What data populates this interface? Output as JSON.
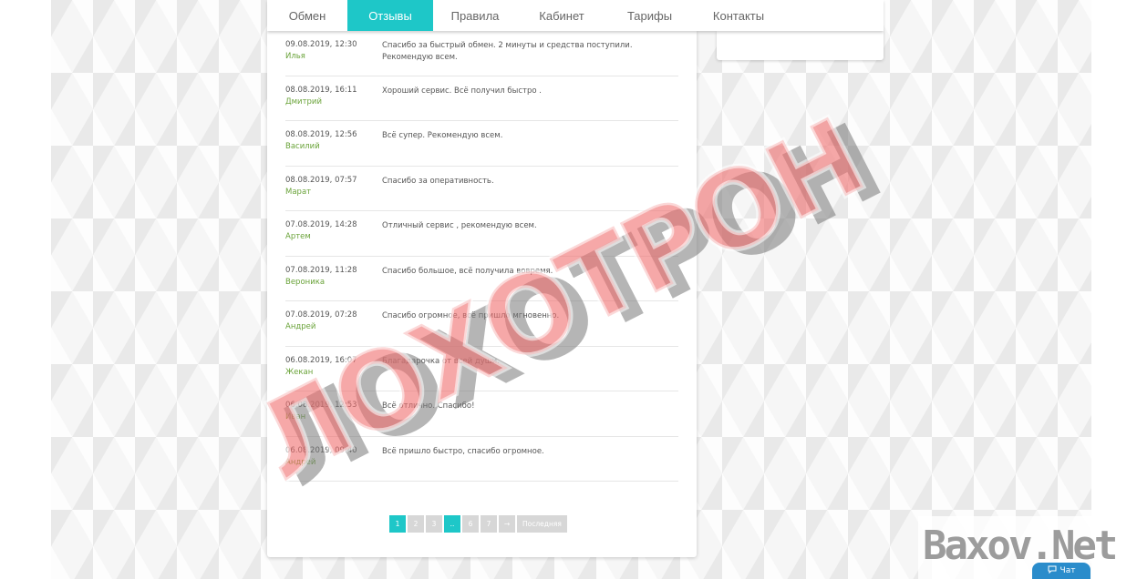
{
  "nav": {
    "tabs": [
      {
        "label": "Обмен"
      },
      {
        "label": "Отзывы"
      },
      {
        "label": "Правила"
      },
      {
        "label": "Кабинет"
      },
      {
        "label": "Тарифы"
      },
      {
        "label": "Контакты"
      }
    ],
    "active_index": 1
  },
  "reviews": [
    {
      "date": "09.08.2019, 12:30",
      "name": "Илья",
      "text": "Спасибо за быстрый обмен. 2 минуты и средства поступили. Рекомендую всем."
    },
    {
      "date": "08.08.2019, 16:11",
      "name": "Дмитрий",
      "text": "Хороший сервис. Всё получил быстро ."
    },
    {
      "date": "08.08.2019, 12:56",
      "name": "Василий",
      "text": "Всё супер. Рекомендую всем."
    },
    {
      "date": "08.08.2019, 07:57",
      "name": "Марат",
      "text": "Спасибо за оперативность."
    },
    {
      "date": "07.08.2019, 14:28",
      "name": "Артем",
      "text": "Отличный сервис , рекомендую всем."
    },
    {
      "date": "07.08.2019, 11:28",
      "name": "Вероника",
      "text": "Спасибо большое, всё получила вовремя."
    },
    {
      "date": "07.08.2019, 07:28",
      "name": "Андрей",
      "text": "Спасибо огромное, всё пришло мгновенно."
    },
    {
      "date": "06.08.2019, 16:07",
      "name": "Жекан",
      "text": "Благадарочка от всей души."
    },
    {
      "date": "06.08.2019, 12:53",
      "name": "Иван",
      "text": "Всё отлично. Спасибо!"
    },
    {
      "date": "06.08.2019, 09:40",
      "name": "Андрей",
      "text": "Всё пришло быстро, спасибо огромное."
    }
  ],
  "pagination": {
    "pages": [
      "1",
      "2",
      "3",
      "..",
      "6",
      "7",
      "→",
      "Последняя"
    ],
    "active_index": 0,
    "highlight_index": 3
  },
  "stamp": {
    "text": "ЛОХОТРОН"
  },
  "watermark": {
    "text": "Baxov.Net"
  },
  "chat": {
    "label": "Чат",
    "icon": "chat-bubble-icon"
  },
  "colors": {
    "accent": "#1ec7c8",
    "name_green": "#6aa339",
    "stamp_red": "#f06e6e"
  }
}
